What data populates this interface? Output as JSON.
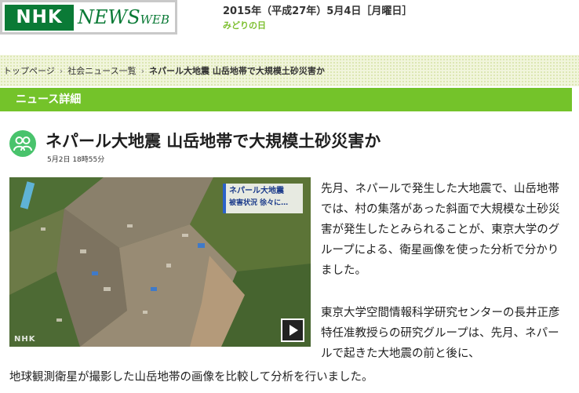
{
  "header": {
    "logo_nhk": "NHK",
    "logo_news": "NEWS",
    "logo_web": "WEB",
    "date": "2015年（平成27年）5月4日［月曜日］",
    "holiday": "みどりの日"
  },
  "breadcrumb": {
    "home": "トップページ",
    "section": "社会ニュース一覧",
    "current": "ネパール大地震 山岳地帯で大規模土砂災害か"
  },
  "section_bar": {
    "label": "ニュース詳細"
  },
  "article": {
    "title": "ネパール大地震 山岳地帯で大規模土砂災害か",
    "time": "5月2日 18時55分",
    "video": {
      "caption_line1": "ネパール大地震",
      "caption_line2": "被害状況 徐々に…",
      "watermark": "NHK",
      "play_icon": "play-icon"
    },
    "paragraph_1": "先月、ネパールで発生した大地震で、山岳地帯では、村の集落があった斜面で大規模な土砂災害が発生したとみられることが、東京大学のグループによる、衛星画像を使った分析で分かりました。",
    "paragraph_2_right": "東京大学空間情報科学研究センターの長井正彦特任准教授らの研究グループは、先月、ネパールで起きた大地震の前と後に、",
    "paragraph_2_full": "地球観測衛星が撮影した山岳地帯の画像を比較して分析を行いました。"
  },
  "colors": {
    "brand_green": "#0a7a36",
    "section_green": "#74c32a",
    "icon_green": "#49c36c"
  }
}
